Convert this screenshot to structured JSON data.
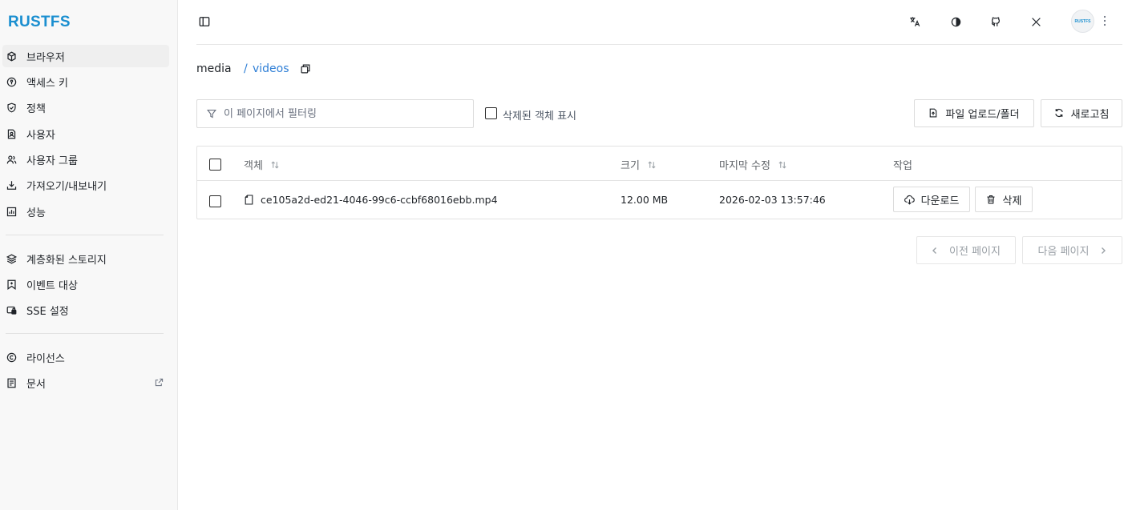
{
  "app": {
    "logo": "RUSTFS",
    "avatar_text": "RUSTFS"
  },
  "sidebar": {
    "items": [
      {
        "label": "브라우저",
        "icon": "cube-icon",
        "active": true
      },
      {
        "label": "액세스 키",
        "icon": "key-circle-icon"
      },
      {
        "label": "정책",
        "icon": "shield-check-icon"
      },
      {
        "label": "사용자",
        "icon": "user-file-icon"
      },
      {
        "label": "사용자 그룹",
        "icon": "users-icon"
      },
      {
        "label": "가져오기/내보내기",
        "icon": "download-tray-icon"
      },
      {
        "label": "성능",
        "icon": "chart-icon"
      }
    ],
    "items2": [
      {
        "label": "계층화된 스토리지",
        "icon": "layers-icon"
      },
      {
        "label": "이벤트 대상",
        "icon": "bookmark-icon"
      },
      {
        "label": "SSE 설정",
        "icon": "lock-card-icon"
      }
    ],
    "items3": [
      {
        "label": "라이선스",
        "icon": "copyright-icon"
      },
      {
        "label": "문서",
        "icon": "doc-icon",
        "external": true
      }
    ]
  },
  "breadcrumb": {
    "root": "media",
    "separator": "/",
    "current": "videos"
  },
  "toolbar": {
    "filter_placeholder": "이 페이지에서 필터링",
    "show_deleted_label": "삭제된 객체 표시",
    "upload_label": "파일 업로드/폴더",
    "refresh_label": "새로고침"
  },
  "table": {
    "headers": {
      "object": "객체",
      "size": "크기",
      "modified": "마지막 수정",
      "action": "작업"
    },
    "rows": [
      {
        "name": "ce105a2d-ed21-4046-99c6-ccbf68016ebb.mp4",
        "size": "12.00 MB",
        "modified": "2026-02-03 13:57:46",
        "download_label": "다운로드",
        "delete_label": "삭제"
      }
    ]
  },
  "pagination": {
    "prev_label": "이전 페이지",
    "next_label": "다음 페이지"
  },
  "colors": {
    "accent": "#1b8fd0",
    "link": "#2f7fd6"
  }
}
